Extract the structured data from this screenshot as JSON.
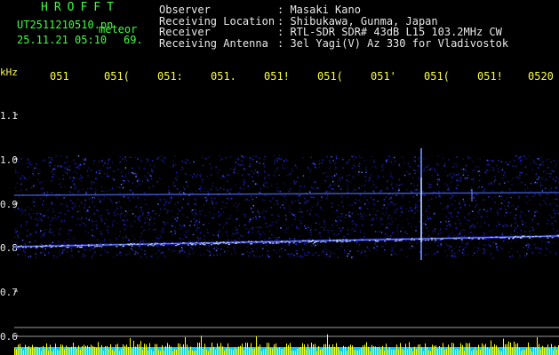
{
  "header": {
    "app_name": "HROFFT",
    "file_name": "UT2511210510.pn",
    "file_suffix": "meteor",
    "date_time": "25.11.21 05:10",
    "value": "69.",
    "info": [
      {
        "key": "Observer",
        "value": ": Masaki Kano"
      },
      {
        "key": "Receiving Location",
        "value": ": Shibukawa, Gunma, Japan"
      },
      {
        "key": "Receiver",
        "value": ": RTL-SDR SDR# 43dB L15 103.2MHz CW"
      },
      {
        "key": "Receiving Antenna",
        "value": ": 3el Yagi(V) Az 330 for Vladivostok"
      }
    ]
  },
  "axis": {
    "y_unit": "kHz",
    "x_ticks": [
      "051",
      "051(",
      "051:",
      "051.",
      "051!",
      "051(",
      "051'",
      "051(",
      "051!",
      "0520"
    ],
    "y_ticks": [
      "1.1",
      "1.0",
      "0.9",
      "0.8",
      "0.7",
      "0.6"
    ]
  },
  "colors": {
    "title_text": "#3cff3c",
    "tick_text": "#ffff40",
    "signal_low": "#1a1aa0",
    "signal_high": "#c8d8ff",
    "bottom_bars": "#ffff00",
    "bottom_base": "#00c8ff"
  }
}
